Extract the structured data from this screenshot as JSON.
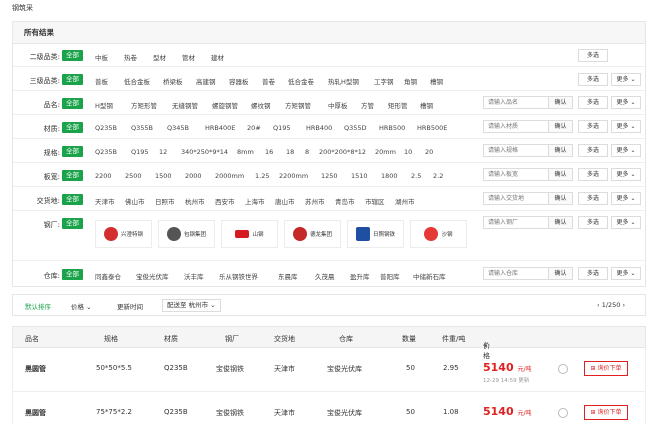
{
  "breadcrumb": "钢筑采",
  "filter": {
    "title": "所有结果",
    "all_label": "全部",
    "multi_label": "多选",
    "more_label": "更多",
    "confirm_label": "确认",
    "rows": [
      {
        "label": "二级品类:",
        "options": [
          "中板",
          "热卷",
          "型材",
          "管材",
          "建材"
        ]
      },
      {
        "label": "三级品类:",
        "options": [
          "普板",
          "低合金板",
          "桥梁板",
          "高建钢",
          "容器板",
          "普卷",
          "低合金卷",
          "热轧H型钢",
          "工字钢",
          "角钢",
          "槽钢"
        ]
      },
      {
        "label": "品名:",
        "options": [
          "H型钢",
          "方矩形管",
          "无缝钢管",
          "螺旋钢管",
          "螺纹钢",
          "方矩钢管",
          "中厚板",
          "方管",
          "矩形管",
          "槽钢"
        ],
        "placeholder": "请输入品名"
      },
      {
        "label": "材质:",
        "options": [
          "Q235B",
          "Q355B",
          "Q345B",
          "HRB400E",
          "20#",
          "Q195",
          "HRB400",
          "Q355D",
          "HRB500",
          "HRB500E"
        ],
        "placeholder": "请输入材质"
      },
      {
        "label": "规格:",
        "options": [
          "Q235B",
          "Q195",
          "12",
          "340*250*9*14",
          "8mm",
          "16",
          "18",
          "8",
          "200*200*8*12",
          "20mm",
          "10",
          "20"
        ],
        "placeholder": "请输入规格"
      },
      {
        "label": "板宽:",
        "options": [
          "2200",
          "2500",
          "1500",
          "2000",
          "2000mm",
          "1.25",
          "2200mm",
          "1250",
          "1510",
          "1800",
          "2.5",
          "2.2"
        ],
        "placeholder": "请输入板宽"
      },
      {
        "label": "交货地:",
        "options": [
          "天津市",
          "佛山市",
          "日照市",
          "杭州市",
          "西安市",
          "上海市",
          "唐山市",
          "苏州市",
          "青岛市",
          "市辖区",
          "湖州市"
        ],
        "placeholder": "请输入交货地"
      },
      {
        "label": "钢厂:",
        "placeholder": "请输入钢厂"
      },
      {
        "label": "仓库:",
        "options": [
          "同鑫泰仓",
          "宝俊光伏库",
          "沃丰库",
          "乐从钢铁世界",
          "东晨库",
          "久茂晨",
          "盈升库",
          "普阳库",
          "中储新石库"
        ],
        "placeholder": "请输入仓库"
      }
    ],
    "mills": [
      {
        "name": "兴澄特钢",
        "color": "#d32f2f"
      },
      {
        "name": "包钢集团",
        "color": "#555555"
      },
      {
        "name": "山钢",
        "color": "#d71920"
      },
      {
        "name": "德龙集团",
        "color": "#c62828"
      },
      {
        "name": "日照钢铁",
        "color": "#1e4fa3"
      },
      {
        "name": "沙钢",
        "color": "#e53935"
      }
    ]
  },
  "sort": {
    "default": "默认排序",
    "price": "价格",
    "update_time": "更新时间",
    "delivery_label": "配送至",
    "delivery_city": "杭州市",
    "pager": "1/250"
  },
  "table": {
    "headers": [
      "品名",
      "规格",
      "材质",
      "钢厂",
      "交货地",
      "仓库",
      "数量",
      "件重/吨",
      "价格"
    ],
    "inquiry_label": "询价下单",
    "rows": [
      {
        "name": "黑圆管",
        "spec": "50*50*5.5",
        "material": "Q235B",
        "mill": "宝俊钢铁",
        "place": "天津市",
        "warehouse": "宝俊光伏库",
        "qty": "50",
        "weight": "2.95",
        "price": "5140",
        "unit": "元/吨",
        "time": "12-29 14:59 更新"
      },
      {
        "name": "黑圆管",
        "spec": "75*75*2.2",
        "material": "Q235B",
        "mill": "宝俊钢铁",
        "place": "天津市",
        "warehouse": "宝俊光伏库",
        "qty": "50",
        "weight": "1.08",
        "price": "5140",
        "unit": "元/吨",
        "time": ""
      }
    ]
  }
}
